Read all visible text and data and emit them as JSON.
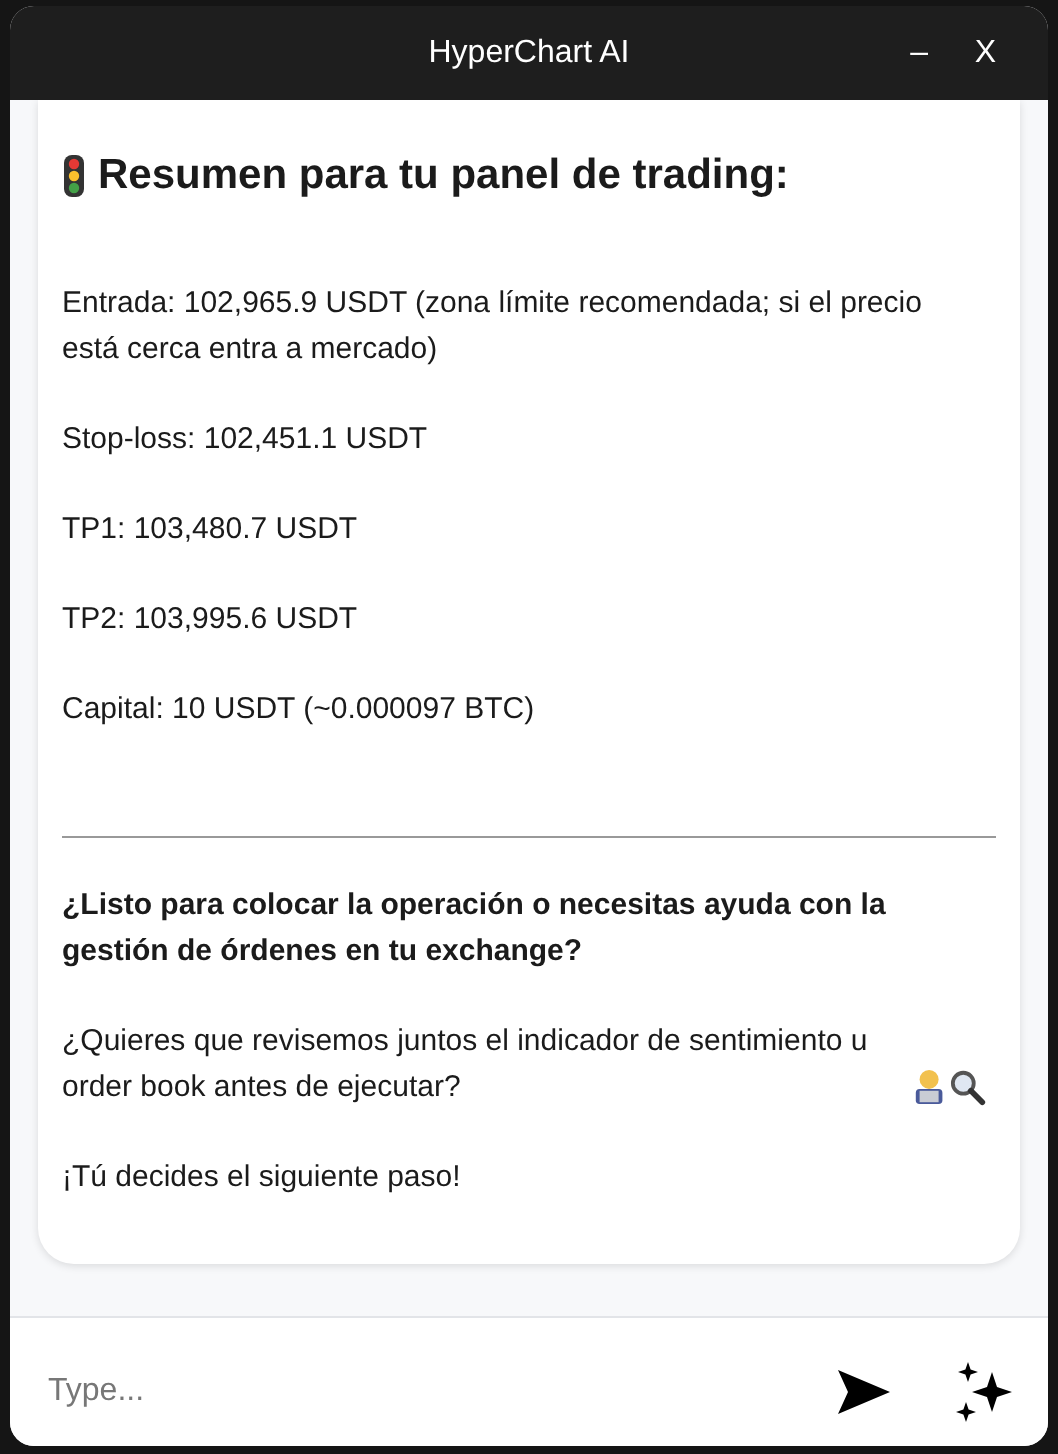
{
  "window": {
    "title": "HyperChart AI",
    "minimize": "–",
    "close": "X"
  },
  "message": {
    "heading": "Resumen para tu panel de trading:",
    "lines": [
      "Entrada: 102,965.9 USDT (zona límite recomendada; si el precio está cerca entra a mercado)",
      "Stop-loss: 102,451.1 USDT",
      "TP1: 103,480.7 USDT",
      "TP2: 103,995.6 USDT",
      "Capital: 10 USDT (~0.000097 BTC)"
    ],
    "question": "¿Listo para colocar la operación o necesitas ayuda con la gestión de órdenes en tu exchange?",
    "follow_up": "¿Quieres que revisemos juntos el indicador de sentimiento u order book antes de ejecutar?",
    "closing": "¡Tú decides el siguiente paso!"
  },
  "composer": {
    "placeholder": "Type..."
  }
}
